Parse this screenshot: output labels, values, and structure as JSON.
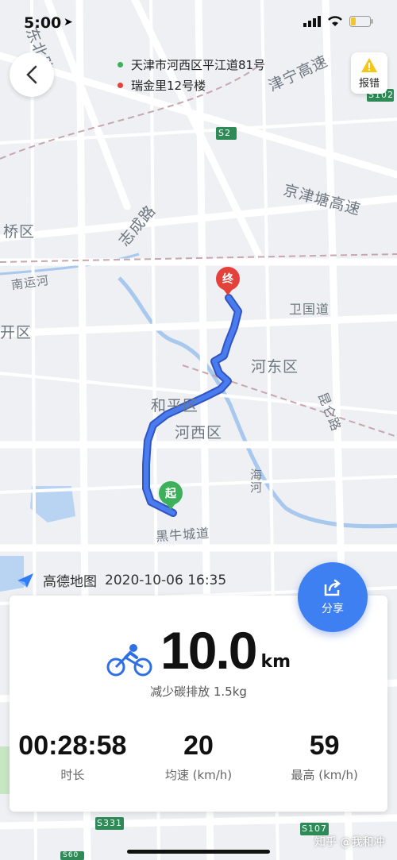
{
  "status_bar": {
    "time": "5:00"
  },
  "route": {
    "start": "天津市河西区平江道81号",
    "end": "瑞金里12号楼",
    "start_color": "#3cb05a",
    "end_color": "#e4413b"
  },
  "report_label": "报错",
  "map_labels": {
    "l1": "东北路",
    "l2": "津宁高速",
    "l3": "京津塘高速",
    "l4": "桥区",
    "l5": "志成路",
    "l6": "南运河",
    "l7": "卫国道",
    "l8": "开区",
    "l9": "河东区",
    "l10": "和平区",
    "l11": "河西区",
    "l12": "海河",
    "l13": "昆仑路",
    "l14": "黑牛城道",
    "s2": "S2",
    "s102": "S102",
    "s331": "S331",
    "s107": "S107",
    "s60": "S60"
  },
  "pins": {
    "end": "终",
    "start": "起"
  },
  "brand": {
    "name": "高德地图",
    "timestamp": "2020-10-06 16:35"
  },
  "share_label": "分享",
  "stats": {
    "distance": "10.0",
    "distance_unit": "km",
    "carbon": "减少碳排放 1.5kg",
    "duration": "00:28:58",
    "duration_label": "时长",
    "avg_speed": "20",
    "avg_speed_label": "均速 (km/h)",
    "max_speed": "59",
    "max_speed_label": "最高 (km/h)"
  },
  "footer_watermark": "知乎 @我和冲",
  "colors": {
    "route": "#3f6fe0",
    "accent": "#3e7ff2"
  }
}
